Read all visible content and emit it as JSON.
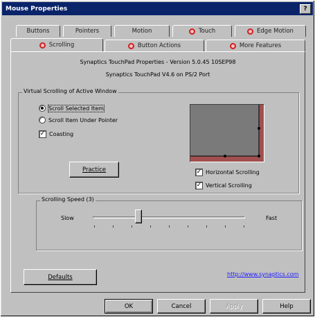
{
  "window": {
    "title": "Mouse Properties",
    "help_glyph": "?"
  },
  "tabs_row_back": [
    {
      "label": "Buttons",
      "icon": ""
    },
    {
      "label": "Pointers",
      "icon": ""
    },
    {
      "label": "Motion",
      "icon": ""
    },
    {
      "label": "Touch",
      "icon": "touchpad-icon"
    },
    {
      "label": "Edge Motion",
      "icon": "touchpad-icon"
    }
  ],
  "tabs_row_front": [
    {
      "label": "Scrolling",
      "icon": "touchpad-icon",
      "active": true
    },
    {
      "label": "Button Actions",
      "icon": "touchpad-icon"
    },
    {
      "label": "More Features",
      "icon": "touchpad-icon"
    }
  ],
  "header": {
    "line1": "Synaptics TouchPad Properties - Version 5.0.45 10SEP98",
    "line2": "Synaptics TouchPad V4.6 on PS/2 Port"
  },
  "virtual_scrolling": {
    "group_label": "Virtual Scrolling of Active Window",
    "option_selected": "Scroll Selected Item",
    "option_under": "Scroll Item Under Pointer",
    "coasting_label": "Coasting",
    "coasting_checked": true,
    "practice_label": "Practice",
    "horizontal_label": "Horizontal Scrolling",
    "horizontal_checked": true,
    "vertical_label": "Vertical Scrolling",
    "vertical_checked": true
  },
  "scrolling_speed": {
    "group_label": "Scrolling Speed (3)",
    "slow_label": "Slow",
    "fast_label": "Fast",
    "value": 3,
    "max": 10
  },
  "footer": {
    "defaults_label": "Defaults",
    "link_text": "http://www.synaptics.com"
  },
  "dialog_buttons": {
    "ok": "OK",
    "cancel": "Cancel",
    "apply": "Apply",
    "help": "Help"
  },
  "colors": {
    "title_bar": "#0a246a",
    "preview_bg": "#7a7a7a",
    "scroll_zone": "#a05050",
    "link": "#1a1aff"
  }
}
